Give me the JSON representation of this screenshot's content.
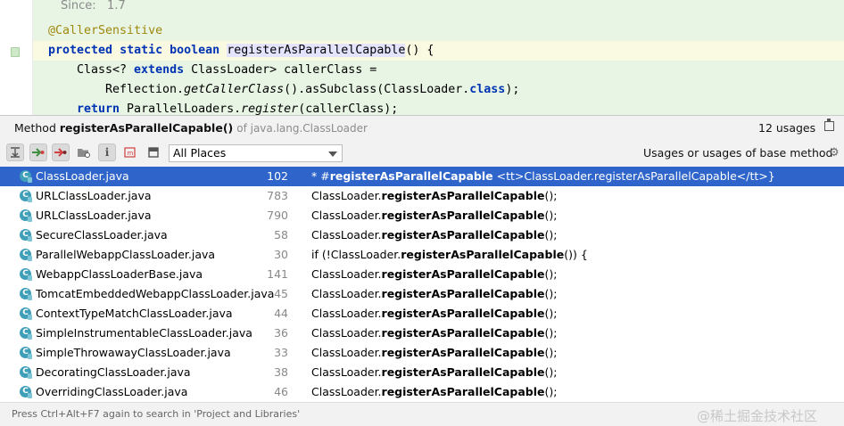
{
  "editor": {
    "since_label": "Since:",
    "since_value": "1.7",
    "annotation": "@CallerSensitive",
    "line_decl": {
      "kw1": "protected",
      "kw2": "static",
      "kw3": "boolean",
      "name": "registerAsParallelCapable",
      "tail": "() {"
    },
    "line_class": {
      "pre": "Class<? ",
      "kw": "extends",
      "post": " ClassLoader> callerClass ="
    },
    "line_reflection": {
      "pre": "Reflection.",
      "italic": "getCallerClass",
      "mid": "().asSubclass(ClassLoader.",
      "kw": "class",
      "post": ");"
    },
    "line_return": {
      "kw": "return",
      "pre": " ParallelLoaders.",
      "italic": "register",
      "post": "(callerClass);"
    }
  },
  "popup": {
    "title_prefix": "Method",
    "method_name": "registerAsParallelCapable()",
    "method_package": "of java.lang.ClassLoader",
    "usage_count": "12 usages",
    "scope": "All Places",
    "usages_mode": "Usages or usages of base method",
    "footer_hint": "Press Ctrl+Alt+F7 again to search in 'Project and Libraries'",
    "watermark": "@稀土掘金技术社区",
    "results": [
      {
        "file": "ClassLoader.java",
        "line": "102",
        "pre": "* #",
        "bold": "registerAsParallelCapable",
        "post": " <tt>ClassLoader.registerAsParallelCapable</tt>}"
      },
      {
        "file": "URLClassLoader.java",
        "line": "783",
        "pre": "ClassLoader.",
        "bold": "registerAsParallelCapable",
        "post": "();"
      },
      {
        "file": "URLClassLoader.java",
        "line": "790",
        "pre": "ClassLoader.",
        "bold": "registerAsParallelCapable",
        "post": "();"
      },
      {
        "file": "SecureClassLoader.java",
        "line": "58",
        "pre": "ClassLoader.",
        "bold": "registerAsParallelCapable",
        "post": "();"
      },
      {
        "file": "ParallelWebappClassLoader.java",
        "line": "30",
        "pre": "if (!ClassLoader.",
        "bold": "registerAsParallelCapable",
        "post": "()) {"
      },
      {
        "file": "WebappClassLoaderBase.java",
        "line": "141",
        "pre": "ClassLoader.",
        "bold": "registerAsParallelCapable",
        "post": "();"
      },
      {
        "file": "TomcatEmbeddedWebappClassLoader.java",
        "line": "45",
        "pre": "ClassLoader.",
        "bold": "registerAsParallelCapable",
        "post": "();"
      },
      {
        "file": "ContextTypeMatchClassLoader.java",
        "line": "44",
        "pre": "ClassLoader.",
        "bold": "registerAsParallelCapable",
        "post": "();"
      },
      {
        "file": "SimpleInstrumentableClassLoader.java",
        "line": "36",
        "pre": "ClassLoader.",
        "bold": "registerAsParallelCapable",
        "post": "();"
      },
      {
        "file": "SimpleThrowawayClassLoader.java",
        "line": "33",
        "pre": "ClassLoader.",
        "bold": "registerAsParallelCapable",
        "post": "();"
      },
      {
        "file": "DecoratingClassLoader.java",
        "line": "38",
        "pre": "ClassLoader.",
        "bold": "registerAsParallelCapable",
        "post": "();"
      },
      {
        "file": "OverridingClassLoader.java",
        "line": "46",
        "pre": "ClassLoader.",
        "bold": "registerAsParallelCapable",
        "post": "();"
      }
    ]
  }
}
